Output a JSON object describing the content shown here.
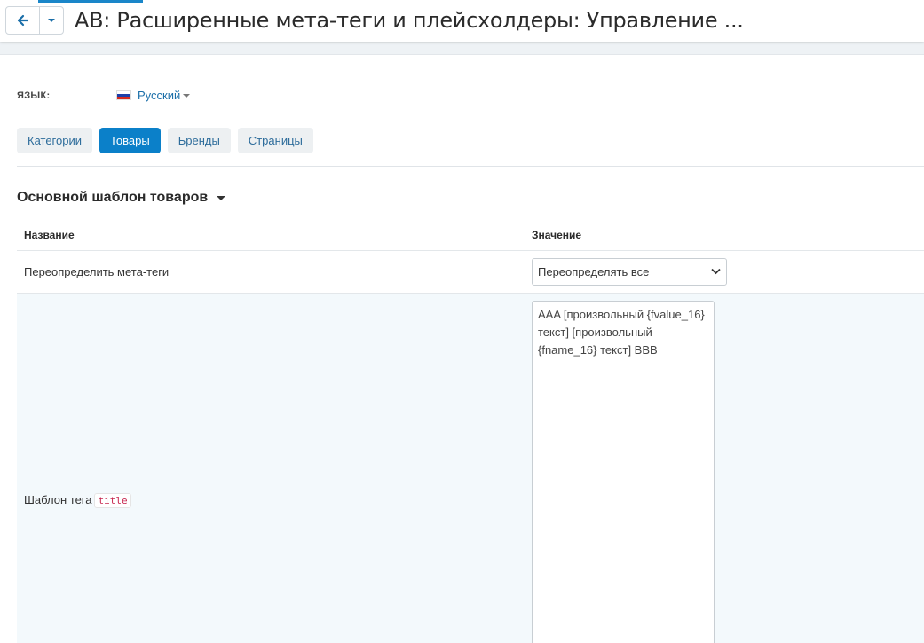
{
  "header": {
    "title": "AB: Расширенные мета-теги и плейсхолдеры: Управление ...",
    "back_icon": "arrow-left-icon",
    "menu_icon": "chevron-down-icon"
  },
  "language": {
    "label": "ЯЗЫК:",
    "selected": "Русский",
    "flag": "russia-flag-icon"
  },
  "tabs": [
    {
      "label": "Категории",
      "active": false
    },
    {
      "label": "Товары",
      "active": true
    },
    {
      "label": "Бренды",
      "active": false
    },
    {
      "label": "Страницы",
      "active": false
    }
  ],
  "section": {
    "title": "Основной шаблон товаров"
  },
  "table": {
    "headers": [
      "Название",
      "Значение"
    ],
    "rows": [
      {
        "name": "Переопределить мета-теги",
        "value": "Переопределять все"
      },
      {
        "name": "Шаблон тега",
        "tag": "title",
        "value": "AAA [произвольный {fvalue_16} текст]  [произвольный {fname_16} текст] BBB"
      }
    ]
  },
  "colors": {
    "accent": "#0b80c9",
    "link": "#1a6ea8",
    "highlight_row": "#f3f9fc"
  }
}
